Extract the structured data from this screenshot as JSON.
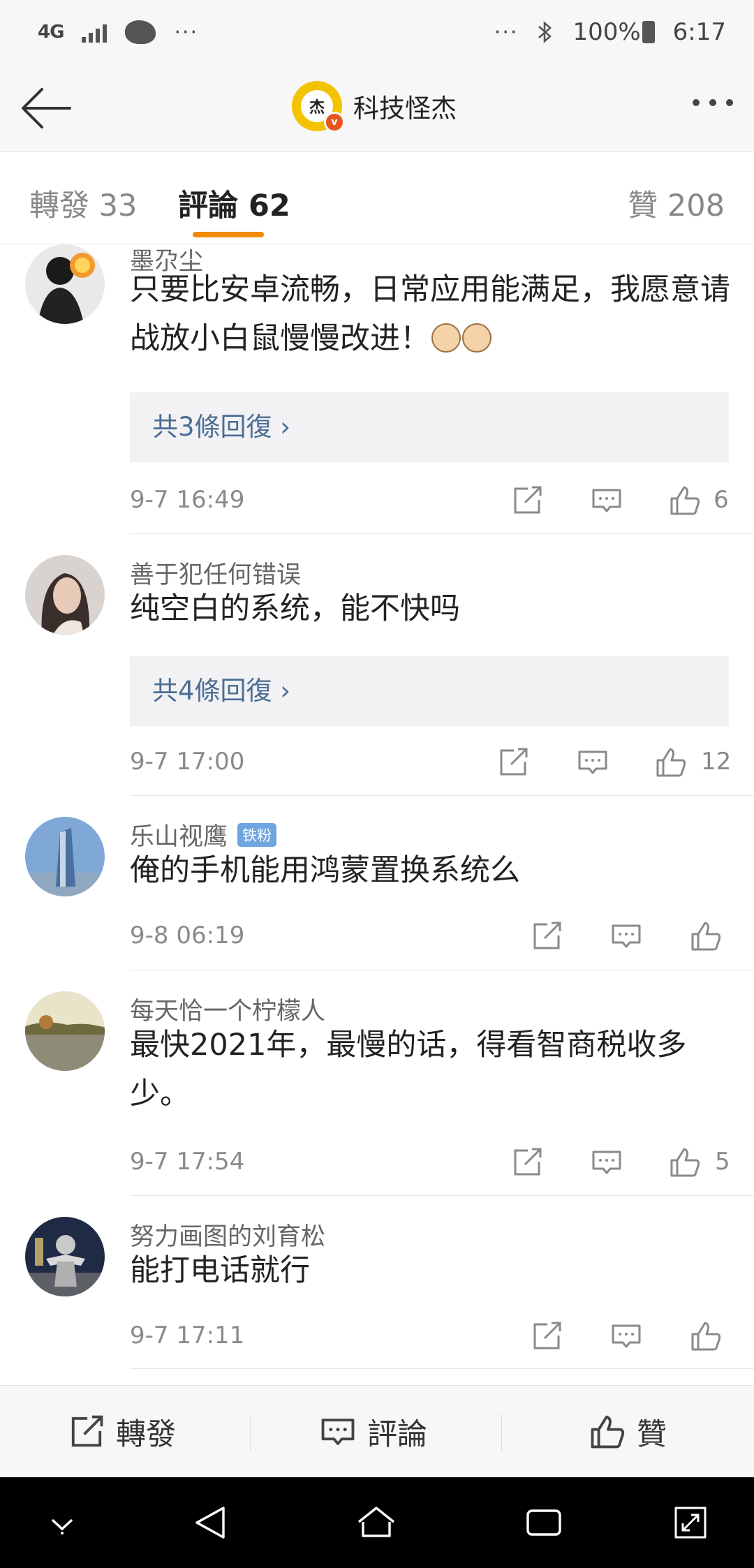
{
  "status_bar": {
    "network": "4G",
    "left_dots": "···",
    "right_dots": "···",
    "battery": "100%",
    "time": "6:17"
  },
  "header": {
    "title": "科技怪杰",
    "avatar_char": "杰",
    "verified_mark": "v"
  },
  "tabs": [
    {
      "label": "轉發 33",
      "active": false
    },
    {
      "label": "評論 62",
      "active": true
    },
    {
      "label": "贊 208",
      "active": false
    }
  ],
  "comments": [
    {
      "username": "墨尕尘",
      "text": "只要比安卓流畅，日常应用能满足，我愿意请战放小白鼠慢慢改进！",
      "emojis": [
        "cat-emoji",
        "cat-emoji"
      ],
      "replies": "共3條回復 ›",
      "time": "9-7 16:49",
      "likes": "6"
    },
    {
      "username": "善于犯任何错误",
      "text": "纯空白的系统，能不快吗",
      "replies": "共4條回復 ›",
      "time": "9-7 17:00",
      "likes": "12"
    },
    {
      "username": "乐山视鹰",
      "badge": "铁粉",
      "text": "俺的手机能用鸿蒙置换系统么",
      "time": "9-8 06:19",
      "likes": ""
    },
    {
      "username": "每天恰一个柠檬人",
      "text": "最快2021年，最慢的话，得看智商税收多少。",
      "time": "9-7 17:54",
      "likes": "5"
    },
    {
      "username": "努力画图的刘育松",
      "text": "能打电话就行",
      "time": "9-7 17:11",
      "likes": ""
    }
  ],
  "action_bar": {
    "repost": "轉發",
    "comment": "評論",
    "like": "贊"
  },
  "colors": {
    "accent_orange": "#f08a00",
    "link_blue": "#4b6d94",
    "badge_blue": "#6fa6e0",
    "avatar_yellow": "#f3c200"
  }
}
